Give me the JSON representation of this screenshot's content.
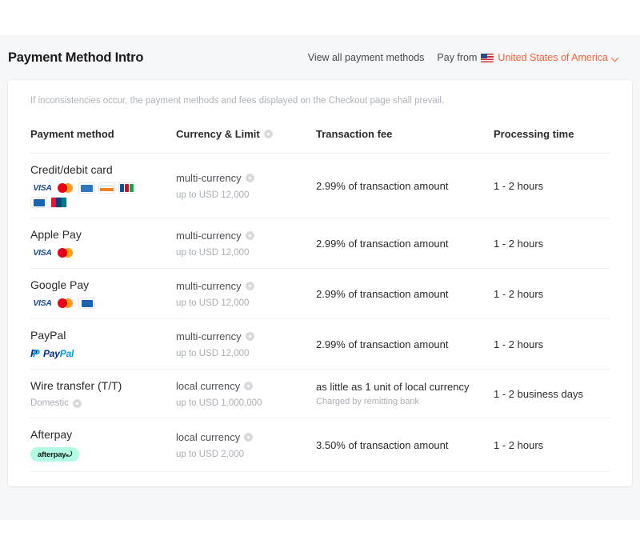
{
  "header": {
    "title": "Payment Method Intro",
    "view_all_label": "View all payment methods",
    "pay_from_label": "Pay from",
    "country": "United States of America",
    "flag_icon": "us-flag-icon",
    "chevron_icon": "chevron-down-icon",
    "accent_color": "#fa6137"
  },
  "disclaimer": "If inconsistencies occur, the payment methods and fees displayed on the Checkout page shall prevail.",
  "table": {
    "columns": {
      "method": "Payment method",
      "currency": "Currency & Limit",
      "fee": "Transaction fee",
      "time": "Processing time"
    },
    "rows": [
      {
        "method": "Credit/debit card",
        "sub": "",
        "logos": [
          "visa",
          "mastercard",
          "amex",
          "discover",
          "jcb",
          "diners",
          "unionpay"
        ],
        "currency": "multi-currency",
        "limit": "up to USD 12,000",
        "fee": "2.99% of transaction amount",
        "fee_sub": "",
        "time": "1 - 2 hours"
      },
      {
        "method": "Apple Pay",
        "sub": "",
        "logos": [
          "visa",
          "mastercard"
        ],
        "currency": "multi-currency",
        "limit": "up to USD 12,000",
        "fee": "2.99% of transaction amount",
        "fee_sub": "",
        "time": "1 - 2 hours"
      },
      {
        "method": "Google Pay",
        "sub": "",
        "logos": [
          "visa",
          "mastercard",
          "diners"
        ],
        "currency": "multi-currency",
        "limit": "up to USD 12,000",
        "fee": "2.99% of transaction amount",
        "fee_sub": "",
        "time": "1 - 2 hours"
      },
      {
        "method": "PayPal",
        "sub": "",
        "logos": [
          "paypal"
        ],
        "currency": "multi-currency",
        "limit": "up to USD 12,000",
        "fee": "2.99% of transaction amount",
        "fee_sub": "",
        "time": "1 - 2 hours"
      },
      {
        "method": "Wire transfer (T/T)",
        "sub": "Domestic",
        "logos": [],
        "currency": "local currency",
        "limit": "up to USD 1,000,000",
        "fee": "as little as 1 unit of local currency",
        "fee_sub": "Charged by remitting bank",
        "time": "1 - 2 business days"
      },
      {
        "method": "Afterpay",
        "sub": "",
        "logos": [
          "afterpay"
        ],
        "currency": "local currency",
        "limit": "up to USD 2,000",
        "fee": "3.50% of transaction amount",
        "fee_sub": "",
        "time": "1 - 2 hours"
      }
    ]
  }
}
